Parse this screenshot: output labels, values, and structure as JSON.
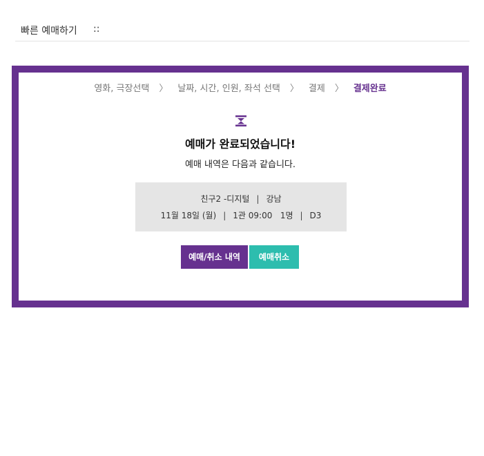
{
  "header": {
    "title": "빠른 예매하기",
    "separator": "::"
  },
  "steps": {
    "step1": "영화, 극장선택",
    "step2": "날짜, 시간, 인원, 좌석 선택",
    "step3": "결제",
    "step4": "결제완료",
    "arrow": "〉"
  },
  "result": {
    "title": "예매가 완료되었습니다!",
    "subtitle": "예매 내역은 다음과 같습니다."
  },
  "summary": {
    "movie": "친구2 -디지털",
    "theater": "강남",
    "date": "11월 18일 (월)",
    "screen_time": "1관 09:00",
    "people": "1명",
    "seat": "D3",
    "pipe": "|"
  },
  "buttons": {
    "history": "예매/취소 내역",
    "cancel": "예매취소"
  },
  "colors": {
    "brand_purple": "#66318f",
    "teal": "#2dbdae",
    "summary_bg": "#e5e5e5"
  },
  "icons": {
    "status": "hourglass-icon"
  }
}
